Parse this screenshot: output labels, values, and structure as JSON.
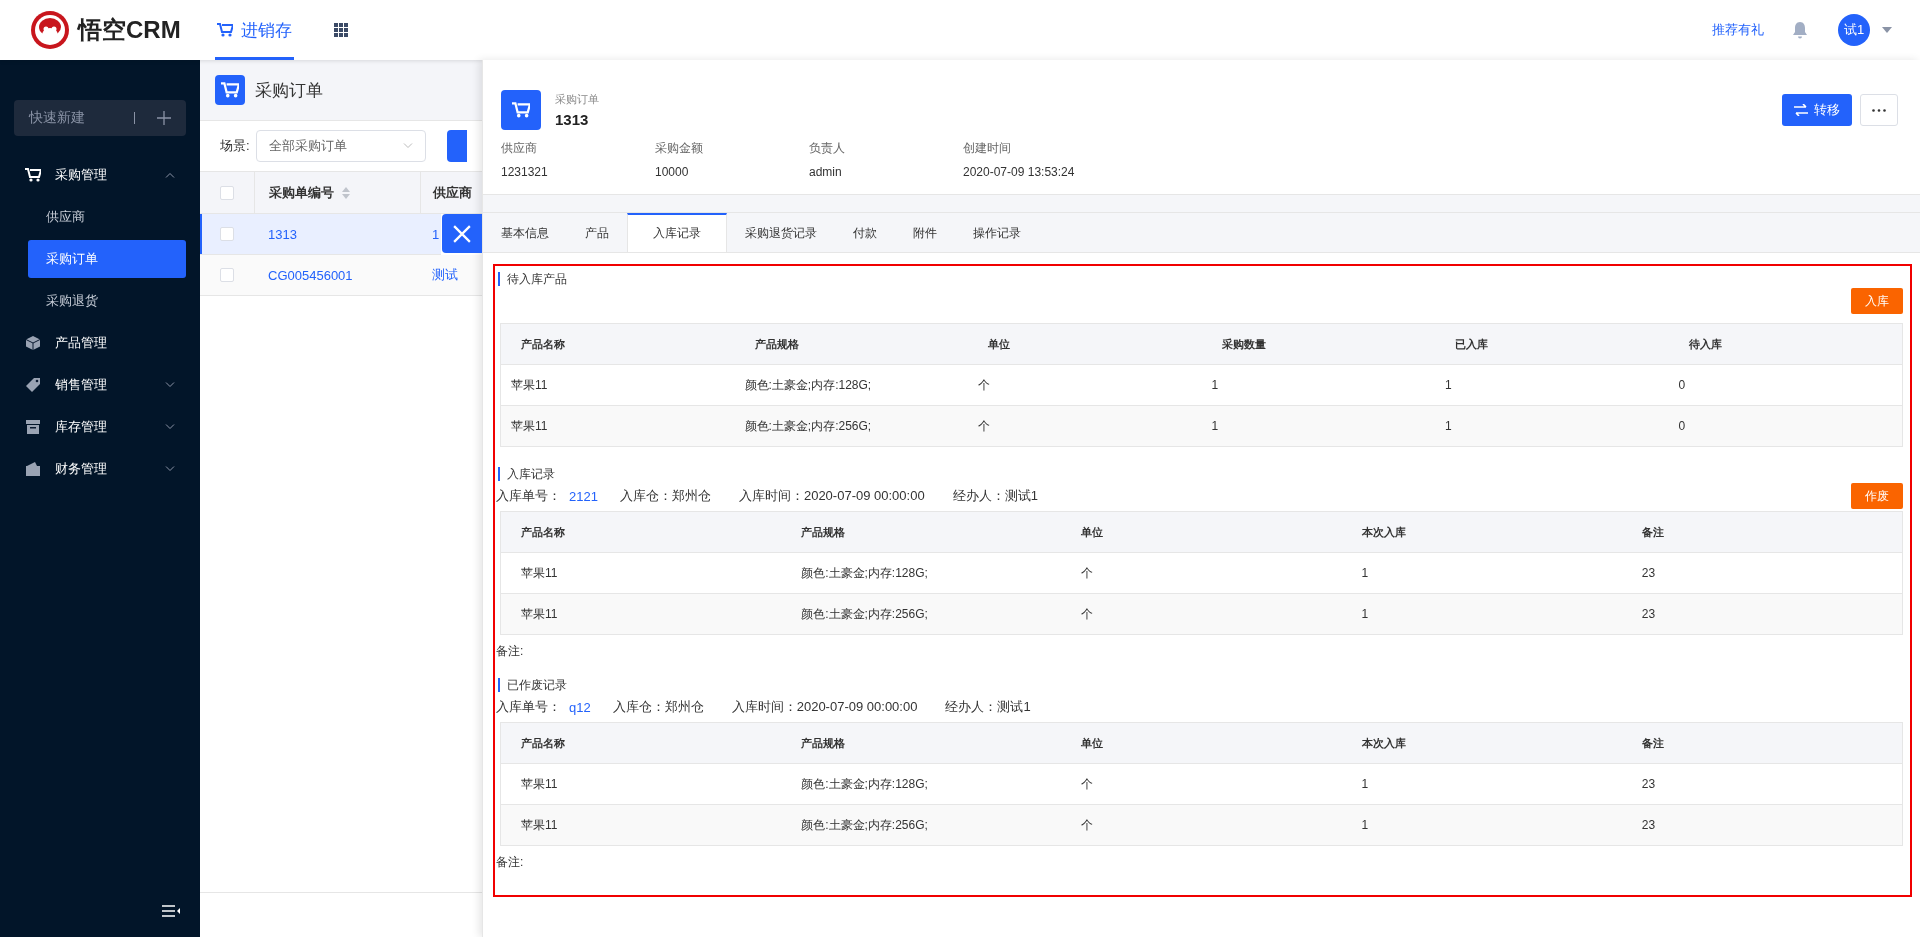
{
  "header": {
    "brand": "悟空CRM",
    "nav": [
      {
        "label": "进销存",
        "selected": true
      }
    ],
    "referral": "推荐有礼",
    "avatar": "试1"
  },
  "sidebar": {
    "quick_new": "快速新建",
    "menu": [
      {
        "label": "采购管理",
        "expanded": true,
        "children": [
          {
            "label": "供应商",
            "selected": false
          },
          {
            "label": "采购订单",
            "selected": true
          },
          {
            "label": "采购退货",
            "selected": false
          }
        ]
      },
      {
        "label": "产品管理"
      },
      {
        "label": "销售管理",
        "expanded": false
      },
      {
        "label": "库存管理",
        "expanded": false
      },
      {
        "label": "财务管理",
        "expanded": false
      }
    ]
  },
  "list_panel": {
    "title": "采购订单",
    "scene_label": "场景:",
    "scene_value": "全部采购订单",
    "all_checked": false,
    "columns": [
      "采购单编号",
      "供应商"
    ],
    "rows": [
      {
        "number": "1313",
        "supplier": "1",
        "selected": true,
        "checked": false
      },
      {
        "number": "CG005456001",
        "supplier": "测试",
        "selected": false,
        "checked": false
      }
    ]
  },
  "detail": {
    "type_label": "采购订单",
    "title": "1313",
    "transfer": "转移",
    "fields": [
      {
        "label": "供应商",
        "value": "1231321"
      },
      {
        "label": "采购金额",
        "value": "10000"
      },
      {
        "label": "负责人",
        "value": "admin"
      },
      {
        "label": "创建时间",
        "value": "2020-07-09 13:53:24"
      }
    ],
    "tabs": [
      {
        "label": "基本信息",
        "selected": false
      },
      {
        "label": "产品",
        "selected": false
      },
      {
        "label": "入库记录",
        "selected": true
      },
      {
        "label": "采购退货记录",
        "selected": false
      },
      {
        "label": "付款",
        "selected": false
      },
      {
        "label": "附件",
        "selected": false
      },
      {
        "label": "操作记录",
        "selected": false
      }
    ],
    "pending": {
      "title": "待入库产品",
      "button": "入库",
      "columns": [
        "产品名称",
        "产品规格",
        "单位",
        "采购数量",
        "已入库",
        "待入库"
      ],
      "rows": [
        [
          "苹果11",
          "颜色:土豪金;内存:128G;",
          "个",
          "1",
          "1",
          "0"
        ],
        [
          "苹果11",
          "颜色:土豪金;内存:256G;",
          "个",
          "1",
          "1",
          "0"
        ]
      ]
    },
    "records": [
      {
        "title": "入库记录",
        "number_label": "入库单号：",
        "number": "2121",
        "items": [
          "入库仓：郑州仓",
          "入库时间：2020-07-09 00:00:00",
          "经办人：测试1"
        ],
        "button": "作废",
        "columns": [
          "产品名称",
          "产品规格",
          "单位",
          "本次入库",
          "备注"
        ],
        "rows": [
          [
            "苹果11",
            "颜色:土豪金;内存:128G;",
            "个",
            "1",
            "23"
          ],
          [
            "苹果11",
            "颜色:土豪金;内存:256G;",
            "个",
            "1",
            "23"
          ]
        ],
        "remark": "备注:"
      },
      {
        "title": "已作废记录",
        "number_label": "入库单号：",
        "number": "q12",
        "items": [
          "入库仓：郑州仓",
          "入库时间：2020-07-09 00:00:00",
          "经办人：测试1"
        ],
        "columns": [
          "产品名称",
          "产品规格",
          "单位",
          "本次入库",
          "备注"
        ],
        "rows": [
          [
            "苹果11",
            "颜色:土豪金;内存:128G;",
            "个",
            "1",
            "23"
          ],
          [
            "苹果11",
            "颜色:土豪金;内存:256G;",
            "个",
            "1",
            "23"
          ]
        ],
        "remark": "备注:"
      }
    ]
  }
}
